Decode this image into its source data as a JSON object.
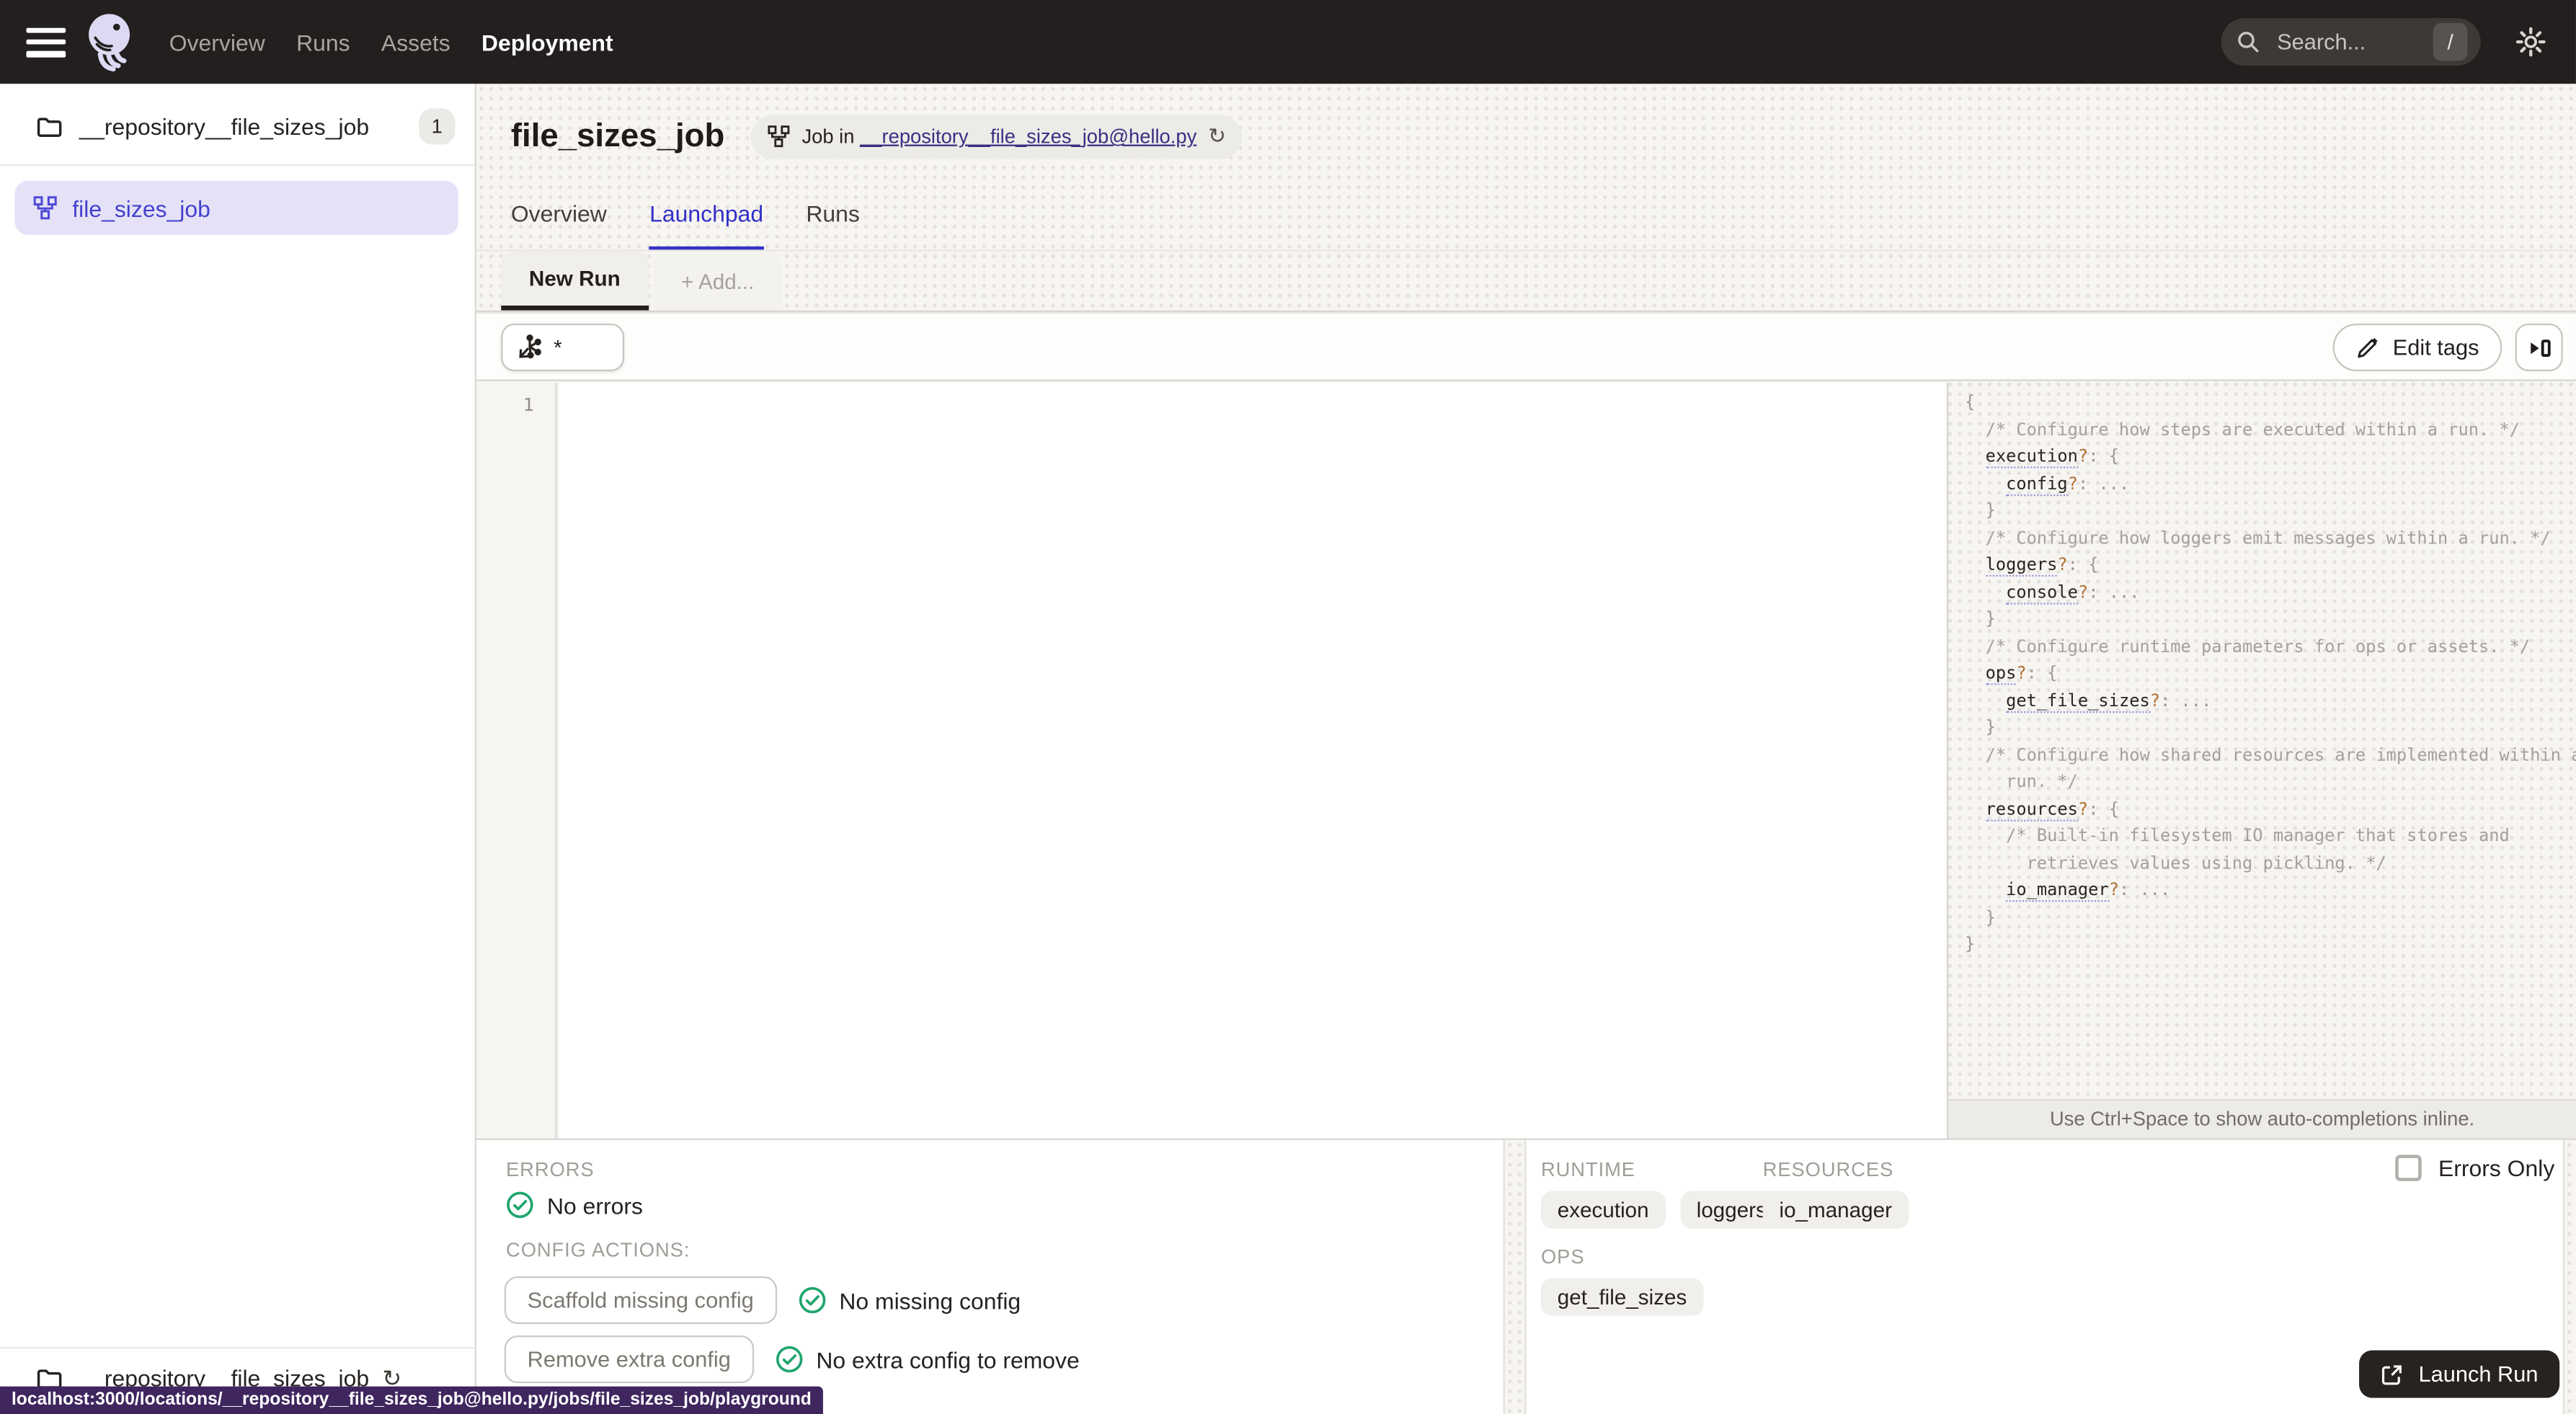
{
  "nav": {
    "items": [
      "Overview",
      "Runs",
      "Assets",
      "Deployment"
    ],
    "search_placeholder": "Search...",
    "search_shortcut": "/"
  },
  "sidebar": {
    "repo_name": "__repository__file_sizes_job",
    "repo_count": "1",
    "job_name": "file_sizes_job",
    "footer_repo": "__repository__file_sizes_job"
  },
  "header": {
    "title": "file_sizes_job",
    "breadcrumb_prefix": "Job in",
    "breadcrumb_link": "__repository__file_sizes_job@hello.py"
  },
  "tabs": {
    "overview": "Overview",
    "launchpad": "Launchpad",
    "runs": "Runs"
  },
  "launchpad": {
    "run_tab": "New Run",
    "add_tab": "+ Add...",
    "op_selector_value": "*",
    "edit_tags": "Edit tags"
  },
  "editor": {
    "line_number": "1"
  },
  "config_schema": {
    "hint": "Use Ctrl+Space to show auto-completions inline.",
    "lines": [
      [
        [
          "punc",
          "{"
        ]
      ],
      [
        [
          "plain",
          "  "
        ],
        [
          "comment",
          "/* Configure how steps are executed within a run. */"
        ]
      ],
      [
        [
          "plain",
          "  "
        ],
        [
          "key",
          "execution"
        ],
        [
          "q",
          "?"
        ],
        [
          "punc",
          ": {"
        ]
      ],
      [
        [
          "plain",
          "    "
        ],
        [
          "key",
          "config"
        ],
        [
          "q",
          "?"
        ],
        [
          "punc",
          ": ..."
        ]
      ],
      [
        [
          "plain",
          "  "
        ],
        [
          "punc",
          "}"
        ]
      ],
      [
        [
          "plain",
          "  "
        ],
        [
          "comment",
          "/* Configure how loggers emit messages within a run. */"
        ]
      ],
      [
        [
          "plain",
          "  "
        ],
        [
          "key",
          "loggers"
        ],
        [
          "q",
          "?"
        ],
        [
          "punc",
          ": {"
        ]
      ],
      [
        [
          "plain",
          "    "
        ],
        [
          "key",
          "console"
        ],
        [
          "q",
          "?"
        ],
        [
          "punc",
          ": ..."
        ]
      ],
      [
        [
          "plain",
          "  "
        ],
        [
          "punc",
          "}"
        ]
      ],
      [
        [
          "plain",
          "  "
        ],
        [
          "comment",
          "/* Configure runtime parameters for ops or assets. */"
        ]
      ],
      [
        [
          "plain",
          "  "
        ],
        [
          "key",
          "ops"
        ],
        [
          "q",
          "?"
        ],
        [
          "punc",
          ": {"
        ]
      ],
      [
        [
          "plain",
          "    "
        ],
        [
          "key",
          "get_file_sizes"
        ],
        [
          "q",
          "?"
        ],
        [
          "punc",
          ": ..."
        ]
      ],
      [
        [
          "plain",
          "  "
        ],
        [
          "punc",
          "}"
        ]
      ],
      [
        [
          "plain",
          "  "
        ],
        [
          "comment",
          "/* Configure how shared resources are implemented within a"
        ]
      ],
      [
        [
          "plain",
          "    "
        ],
        [
          "comment",
          "run. */"
        ]
      ],
      [
        [
          "plain",
          "  "
        ],
        [
          "key",
          "resources"
        ],
        [
          "q",
          "?"
        ],
        [
          "punc",
          ": {"
        ]
      ],
      [
        [
          "plain",
          "    "
        ],
        [
          "comment",
          "/* Built-in filesystem IO manager that stores and"
        ]
      ],
      [
        [
          "plain",
          "      "
        ],
        [
          "comment",
          "retrieves values using pickling. */"
        ]
      ],
      [
        [
          "plain",
          "    "
        ],
        [
          "key",
          "io_manager"
        ],
        [
          "q",
          "?"
        ],
        [
          "punc",
          ": ..."
        ]
      ],
      [
        [
          "plain",
          "  "
        ],
        [
          "punc",
          "}"
        ]
      ],
      [
        [
          "punc",
          "}"
        ]
      ]
    ]
  },
  "bottom": {
    "errors_label": "ERRORS",
    "no_errors": "No errors",
    "config_actions_label": "CONFIG ACTIONS:",
    "scaffold_button": "Scaffold missing config",
    "no_missing": "No missing config",
    "remove_button": "Remove extra config",
    "no_extra": "No extra config to remove",
    "runtime_label": "RUNTIME",
    "runtime_tags": [
      "execution",
      "loggers"
    ],
    "resources_label": "RESOURCES",
    "resources_tags": [
      "io_manager"
    ],
    "ops_label": "OPS",
    "ops_tags": [
      "get_file_sizes"
    ],
    "errors_only": "Errors Only",
    "launch_run": "Launch Run"
  },
  "status_bar": {
    "url": "localhost:3000/locations/__repository__file_sizes_job@hello.py/jobs/file_sizes_job/playground"
  },
  "colors": {
    "accent_blue": "#3330c8",
    "link_purple": "#3b2e83",
    "selected_item_bg": "#e5e2f8",
    "selected_item_text": "#4340ce",
    "success_green": "#1fa56e",
    "tooltip_purple": "#3f265e",
    "nav_bg": "#221f1e"
  }
}
